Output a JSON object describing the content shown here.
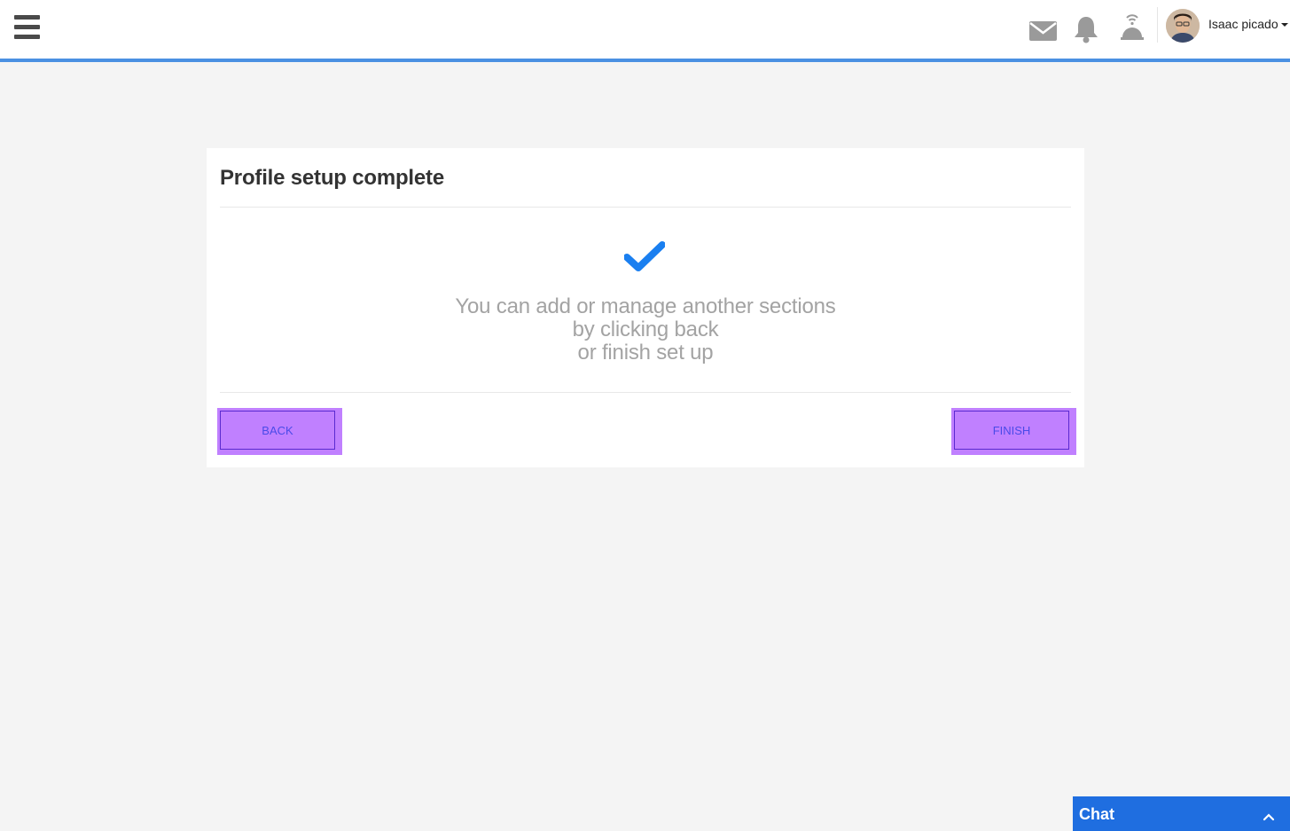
{
  "header": {
    "menu_icon": "hamburger-icon",
    "icons": [
      "mail-icon",
      "bell-icon",
      "signal-icon"
    ],
    "user_name": "Isaac picado",
    "accent_color": "#4a90e2"
  },
  "card": {
    "title": "Profile setup complete",
    "check_color": "#1a7ff0",
    "message_lines": [
      "You can add or manage another sections",
      "by clicking back",
      "or finish set up"
    ],
    "back_label": "BACK",
    "finish_label": "FINISH"
  },
  "chat": {
    "label": "Chat",
    "bg_color": "#1f6ee0"
  }
}
